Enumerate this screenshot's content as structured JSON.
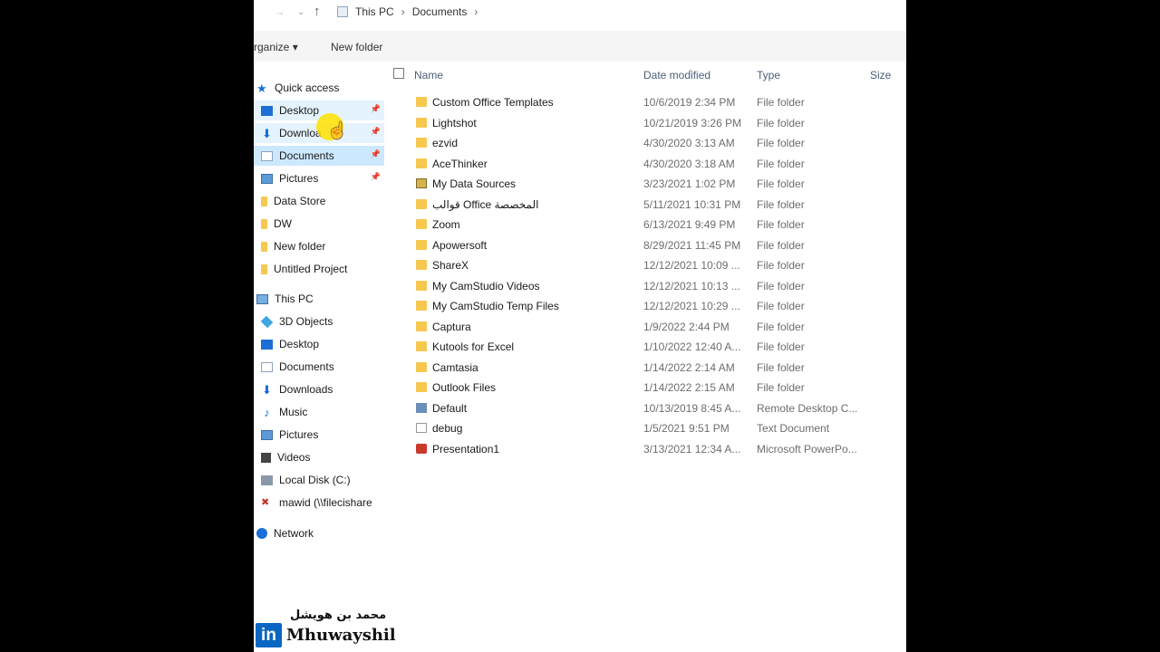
{
  "address": {
    "segments": [
      "This PC",
      "Documents"
    ]
  },
  "toolbar": {
    "organize": "rganize ▾",
    "new_folder": "New folder"
  },
  "sidebar": {
    "quick_access": "Quick access",
    "quick_items": [
      "Desktop",
      "Downloa",
      "Documents",
      "Pictures",
      "Data Store",
      "DW",
      "New folder",
      "Untitled Project"
    ],
    "this_pc": "This PC",
    "pc_items": [
      "3D Objects",
      "Desktop",
      "Documents",
      "Downloads",
      "Music",
      "Pictures",
      "Videos",
      "Local Disk (C:)",
      "mawid (\\\\filecishare"
    ],
    "network": "Network"
  },
  "columns": {
    "name": "Name",
    "date": "Date modified",
    "type": "Type",
    "size": "Size"
  },
  "files": [
    {
      "name": "Custom Office Templates",
      "date": "10/6/2019 2:34 PM",
      "type": "File folder",
      "icon": "folder"
    },
    {
      "name": "Lightshot",
      "date": "10/21/2019 3:26 PM",
      "type": "File folder",
      "icon": "folder"
    },
    {
      "name": "ezvid",
      "date": "4/30/2020 3:13 AM",
      "type": "File folder",
      "icon": "folder"
    },
    {
      "name": "AceThinker",
      "date": "4/30/2020 3:18 AM",
      "type": "File folder",
      "icon": "folder"
    },
    {
      "name": "My Data Sources",
      "date": "3/23/2021 1:02 PM",
      "type": "File folder",
      "icon": "dsfolder"
    },
    {
      "name": "قوالب Office المخصصة",
      "date": "5/11/2021 10:31 PM",
      "type": "File folder",
      "icon": "folder"
    },
    {
      "name": "Zoom",
      "date": "6/13/2021 9:49 PM",
      "type": "File folder",
      "icon": "folder"
    },
    {
      "name": "Apowersoft",
      "date": "8/29/2021 11:45 PM",
      "type": "File folder",
      "icon": "folder"
    },
    {
      "name": "ShareX",
      "date": "12/12/2021 10:09 ...",
      "type": "File folder",
      "icon": "folder"
    },
    {
      "name": "My CamStudio Videos",
      "date": "12/12/2021 10:13 ...",
      "type": "File folder",
      "icon": "folder"
    },
    {
      "name": "My CamStudio Temp Files",
      "date": "12/12/2021 10:29 ...",
      "type": "File folder",
      "icon": "folder"
    },
    {
      "name": "Captura",
      "date": "1/9/2022 2:44 PM",
      "type": "File folder",
      "icon": "folder"
    },
    {
      "name": "Kutools for Excel",
      "date": "1/10/2022 12:40 A...",
      "type": "File folder",
      "icon": "folder"
    },
    {
      "name": "Camtasia",
      "date": "1/14/2022 2:14 AM",
      "type": "File folder",
      "icon": "folder"
    },
    {
      "name": "Outlook Files",
      "date": "1/14/2022 2:15 AM",
      "type": "File folder",
      "icon": "folder"
    },
    {
      "name": "Default",
      "date": "10/13/2019 8:45 A...",
      "type": "Remote Desktop C...",
      "icon": "rdp"
    },
    {
      "name": "debug",
      "date": "1/5/2021 9:51 PM",
      "type": "Text Document",
      "icon": "txt"
    },
    {
      "name": "Presentation1",
      "date": "3/13/2021 12:34 A...",
      "type": "Microsoft PowerPo...",
      "icon": "ppt"
    }
  ],
  "watermark": {
    "arabic_name": "محمد بن هويشل",
    "linkedin": "in",
    "name": "Mhuwayshil"
  }
}
